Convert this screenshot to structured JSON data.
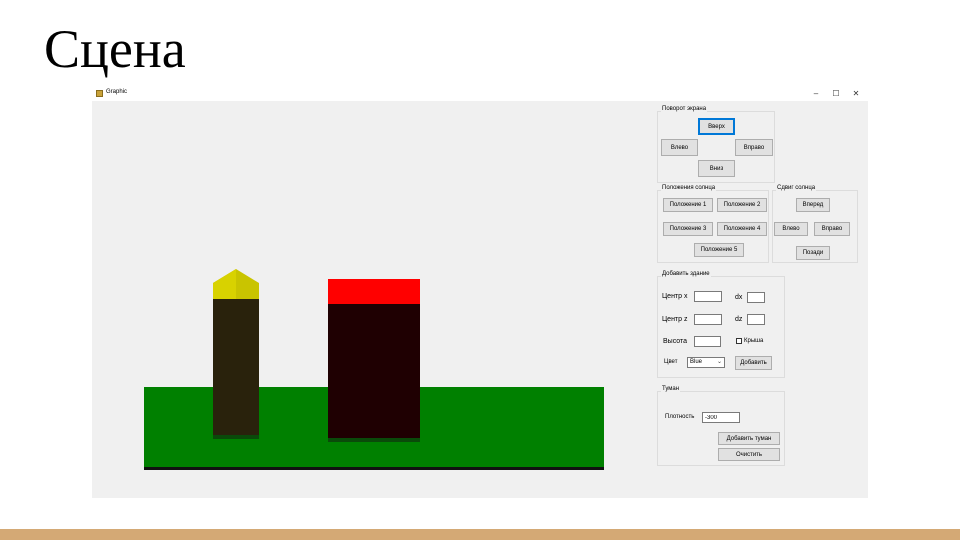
{
  "slide": {
    "title": "Сцена"
  },
  "window": {
    "title": "Graphic",
    "minimize": "–",
    "maximize": "☐",
    "close": "✕"
  },
  "screen_rotation": {
    "title": "Поворот экрана",
    "up": "Вверх",
    "left": "Влево",
    "right": "Вправо",
    "down": "Вниз"
  },
  "sun_position": {
    "title": "Положения солнца",
    "p1": "Положение 1",
    "p2": "Положение 2",
    "p3": "Положение 3",
    "p4": "Положение 4",
    "p5": "Положение 5"
  },
  "sun_shift": {
    "title": "Сдвиг солнца",
    "forward": "Вперед",
    "left": "Влево",
    "right": "Вправо",
    "back": "Позади"
  },
  "add_building": {
    "title": "Добавить здание",
    "center_x": "Центр x",
    "center_x_value": "",
    "dx": "dx",
    "dx_value": "",
    "center_z": "Центр z",
    "center_z_value": "",
    "dz": "dz",
    "dz_value": "",
    "height": "Высота",
    "height_value": "",
    "roof": "Крыша",
    "color_label": "Цвет",
    "color_value": "Blue",
    "add": "Добавить"
  },
  "fog": {
    "title": "Туман",
    "density": "Плотность",
    "density_value": "-300",
    "add": "Добавить туман",
    "clear": "Очистить"
  },
  "colors": {
    "ground": "#008000",
    "building1_body": "#29220c",
    "building1_roof": "#c9c400",
    "building2_body": "#1f0002",
    "building2_roof": "#ff0000",
    "accent_focus": "#0078d7",
    "bottom_bar": "#d4a975"
  }
}
